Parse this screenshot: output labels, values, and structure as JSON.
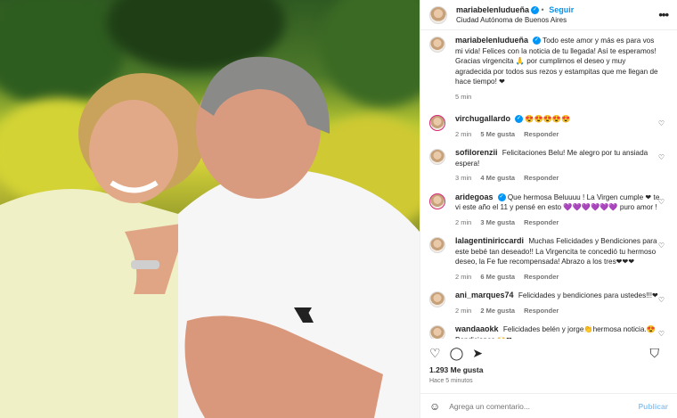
{
  "post": {
    "image_alt": "photo",
    "author": "mariabelenludueña",
    "follow_label": "Seguir",
    "location": "Ciudad Autónoma de Buenos Aires",
    "more_label": "•••"
  },
  "caption": {
    "author": "mariabelenludueña",
    "text": "Todo este amor y más es para vos mi vida! Felices con la noticia de tu llegada! Así te esperamos! Gracias virgencita 🙏 por cumplirnos el deseo y muy agradecida por todos sus rezos y estampitas que me llegan de hace tiempo! ❤",
    "time": "5 min"
  },
  "comments": [
    {
      "user": "virchugallardo",
      "verified": true,
      "text": "😍😍😍😍😍",
      "time": "2 min",
      "likes": "5 Me gusta",
      "reply": "Responder"
    },
    {
      "user": "sofilorenzii",
      "verified": false,
      "text": "Felicitaciones Belu! Me alegro por tu ansiada espera!",
      "time": "3 min",
      "likes": "4 Me gusta",
      "reply": "Responder"
    },
    {
      "user": "aridegoas",
      "verified": true,
      "text": "Que hermosa Beluuuu ! La Virgen cumple ❤ te vi este año el 11 y pensé en esto 💜💜💜💜💜💜 puro amor !",
      "time": "2 min",
      "likes": "3 Me gusta",
      "reply": "Responder"
    },
    {
      "user": "lalagentiniriccardi",
      "verified": false,
      "text": "Muchas Felicidades y Bendiciones para este bebé tan deseado!! La Virgencita te concedió tu hermoso deseo, la Fe fue recompensada! Abrazo a los tres❤❤❤",
      "time": "2 min",
      "likes": "6 Me gusta",
      "reply": "Responder"
    },
    {
      "user": "ani_marques74",
      "verified": false,
      "text": "Felicidades y bendiciones para ustedes!!!❤",
      "time": "2 min",
      "likes": "2 Me gusta",
      "reply": "Responder"
    },
    {
      "user": "wandaaokk",
      "verified": false,
      "text": "Felicidades belén y jorge👏hermosa noticia.😍 Bendiciones 🙌❤",
      "time": "",
      "likes": "",
      "reply": ""
    }
  ],
  "actions": {
    "like_icon": "♡",
    "comment_icon": "◯",
    "share_icon": "➤",
    "save_icon": "⛉"
  },
  "likes": "1.293 Me gusta",
  "posted_ago": "Hace 5 minutos",
  "add_comment": {
    "placeholder": "Agrega un comentario...",
    "publish_label": "Publicar",
    "emoji_icon": "☺"
  },
  "colors": {
    "accent": "#0095f6",
    "heart": "#ed1a3b"
  }
}
